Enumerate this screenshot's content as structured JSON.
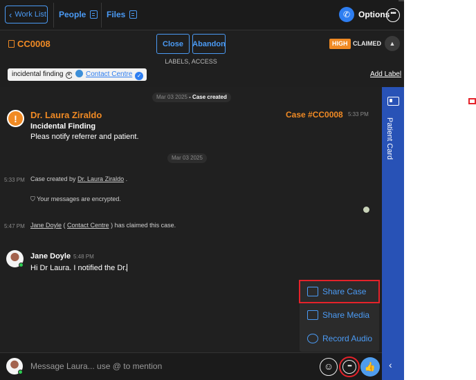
{
  "nav": {
    "worklist_label": "Work List",
    "people_label": "People",
    "files_label": "Files",
    "options_label": "Options"
  },
  "case": {
    "id": "CC0008",
    "close_label": "Close",
    "abandon_label": "Abandon",
    "labels_access": "LABELS, ACCESS",
    "priority": "HIGH",
    "status": "CLAIMED",
    "tags": [
      "incidental finding",
      "Contact Centre"
    ],
    "add_label": "Add Label"
  },
  "chat": {
    "date_pill_1_date": "Mar 03 2025",
    "date_pill_1_event": " - Case created",
    "date_pill_2": "Mar 03 2025",
    "case_message": {
      "author": "Dr. Laura Ziraldo",
      "case_number": "Case #CC0008",
      "time": "5:33 PM",
      "title": "Incidental Finding",
      "body": "Pleas notify referrer and patient."
    },
    "system_1": {
      "time": "5:33 PM",
      "prefix": "Case created by ",
      "link": "Dr. Laura Ziraldo",
      "suffix": " ."
    },
    "encrypted_text": "Your messages are encrypted.",
    "system_2": {
      "time": "5:47 PM",
      "user": "Jane Doyle",
      "open": " ( ",
      "org": "Contact Centre",
      "suffix": " ) has claimed this case."
    },
    "reply": {
      "author": "Jane Doyle",
      "time": "5:48 PM",
      "text": "Hi Dr Laura. I notified the Dr."
    }
  },
  "menu": {
    "items": [
      "Share Case",
      "Share Media",
      "Record Audio"
    ]
  },
  "composer": {
    "placeholder": "Message Laura... use @ to mention"
  },
  "panel": {
    "label": "Patient Card"
  },
  "colors": {
    "accent": "#4b9bf5",
    "orange": "#f08a24",
    "panel": "#2852b6",
    "highlight": "#e5222a"
  }
}
